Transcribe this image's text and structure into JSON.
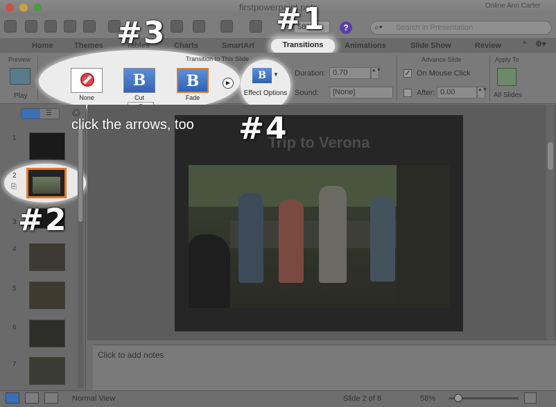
{
  "window": {
    "title": "firstpowerpoint.pptx",
    "right_partial": "Online Ann Carter"
  },
  "toolbar": {
    "zoom": "58%",
    "search_placeholder": "Search in Presentation",
    "help_label": "?"
  },
  "ribbon_tabs": [
    {
      "label": "Home"
    },
    {
      "label": "Themes"
    },
    {
      "label": "Tables"
    },
    {
      "label": "Charts"
    },
    {
      "label": "SmartArt"
    },
    {
      "label": "Transitions",
      "active": true
    },
    {
      "label": "Animations"
    },
    {
      "label": "Slide Show"
    },
    {
      "label": "Review"
    }
  ],
  "preview_group": {
    "label": "Preview",
    "play_label": "Play"
  },
  "transition_group": {
    "label": "Transition to This Slide",
    "items": [
      {
        "label": "None"
      },
      {
        "label": "Cut",
        "glyph": "B"
      },
      {
        "label": "Fade",
        "glyph": "B"
      }
    ]
  },
  "effect_options": {
    "label": "Effect Options",
    "glyph": "B"
  },
  "timing": {
    "duration_label": "Duration:",
    "duration_value": "0.70",
    "sound_label": "Sound:",
    "sound_value": "[None]"
  },
  "advance_group": {
    "label": "Advance Slide",
    "on_mouse_click": "On Mouse Click",
    "after_label": "After:",
    "after_value": "0.00"
  },
  "apply_group": {
    "label": "Apply To",
    "all_slides": "All Slides"
  },
  "slides": [
    {
      "num": "1"
    },
    {
      "num": "2"
    },
    {
      "num": "3"
    },
    {
      "num": "4"
    },
    {
      "num": "5"
    },
    {
      "num": "6"
    },
    {
      "num": "7"
    }
  ],
  "slide": {
    "title": "Trip to Verona"
  },
  "notes": {
    "placeholder": "Click to add notes"
  },
  "status": {
    "view": "Normal View",
    "slide_info": "Slide 2 of 8",
    "zoom": "58%"
  },
  "annotations": {
    "a1": "#1",
    "a2": "#2",
    "a3": "#3",
    "a4": "#4",
    "hint": "click the arrows, too"
  },
  "colors": {
    "accent_selected": "#e27a2a",
    "transition_blue": "#2f62b5",
    "highlight": "#ececec"
  }
}
